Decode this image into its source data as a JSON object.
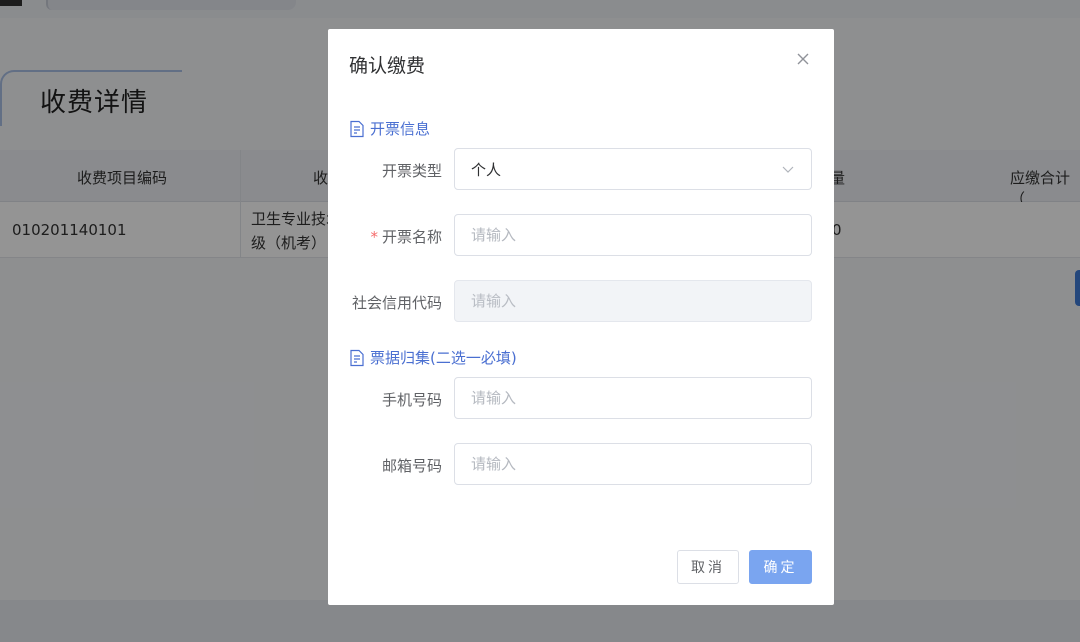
{
  "background": {
    "section_title": "收费详情",
    "table": {
      "headers": [
        "收费项目编码",
        "收",
        "量",
        "应缴合计（"
      ],
      "row": {
        "code": "010201140101",
        "name_line1": "卫生专业技术",
        "name_line2": "级（机考）",
        "qty": "0"
      }
    }
  },
  "dialog": {
    "title": "确认缴费",
    "close_icon": "close-icon",
    "invoice_section": {
      "icon": "document-icon",
      "label": "开票信息"
    },
    "invoice_type": {
      "label": "开票类型",
      "value": "个人",
      "options": [
        "个人"
      ]
    },
    "invoice_name": {
      "label": "开票名称",
      "required_mark": "*",
      "placeholder": "请输入",
      "value": ""
    },
    "credit_code": {
      "label": "社会信用代码",
      "placeholder": "请输入",
      "disabled": true
    },
    "collection_section": {
      "icon": "document-icon",
      "label": "票据归集(二选一必填)"
    },
    "phone": {
      "label": "手机号码",
      "placeholder": "请输入"
    },
    "email": {
      "label": "邮箱号码",
      "placeholder": "请输入"
    },
    "buttons": {
      "cancel": "取消",
      "confirm": "确定"
    }
  },
  "colors": {
    "accent": "#4a6fd1",
    "primary_button": "#7aa5f0",
    "required": "#f56c6c",
    "overlay": "rgba(0,0,0,0.42)"
  }
}
